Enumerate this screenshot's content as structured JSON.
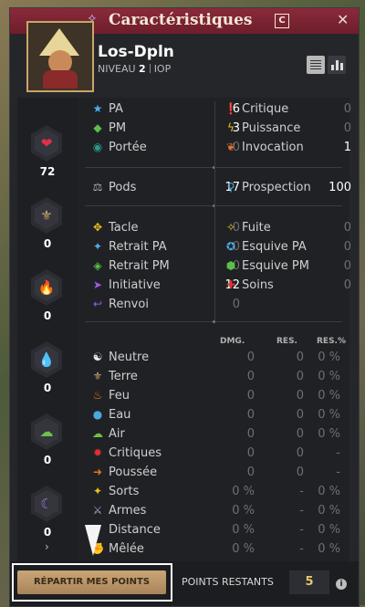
{
  "window": {
    "title": "Caractéristiques",
    "title_badge": "C",
    "close_label": "✕"
  },
  "character": {
    "name": "Los-Dpln",
    "level_label": "NIVEAU",
    "level": "2",
    "class": "IOP"
  },
  "elements_sidebar": [
    {
      "name": "vitalite",
      "icon": "heart-icon",
      "glyph": "❤",
      "color": "#e0304a",
      "value": "72"
    },
    {
      "name": "sagesse",
      "icon": "sprout-icon",
      "glyph": "⚜",
      "color": "#c9a56a",
      "value": "0"
    },
    {
      "name": "force",
      "icon": "flame-icon",
      "glyph": "🔥",
      "color": "#e07a20",
      "value": "0"
    },
    {
      "name": "intelligence",
      "icon": "drop-icon",
      "glyph": "💧",
      "color": "#4aa8e0",
      "value": "0"
    },
    {
      "name": "chance",
      "icon": "cloud-icon",
      "glyph": "☁",
      "color": "#6ac24a",
      "value": "0"
    },
    {
      "name": "agilite",
      "icon": "moon-icon",
      "glyph": "☾",
      "color": "#9a7ae0",
      "value": "0"
    }
  ],
  "sidebar_more": "›",
  "stats_top_left": [
    {
      "label": "PA",
      "value": "6",
      "icon": "star-icon",
      "glyph": "★",
      "color": "#4ab0e8"
    },
    {
      "label": "PM",
      "value": "3",
      "icon": "diamond-icon",
      "glyph": "◆",
      "color": "#5ac04a"
    },
    {
      "label": "Portée",
      "value": "0",
      "icon": "eye-icon",
      "glyph": "◉",
      "color": "#2a9a8a"
    }
  ],
  "stats_top_right": [
    {
      "label": "Critique",
      "value": "0",
      "icon": "exclamation-icon",
      "glyph": "❗",
      "color": "#e03030"
    },
    {
      "label": "Puissance",
      "value": "0",
      "icon": "lightning-icon",
      "glyph": "ϟ",
      "color": "#e8c020"
    },
    {
      "label": "Invocation",
      "value": "1",
      "icon": "invocation-icon",
      "glyph": "❦",
      "color": "#e07030"
    }
  ],
  "pods": {
    "label": "Pods",
    "value": "17",
    "icon": "weight-icon",
    "glyph": "⚖",
    "color": "#b0b0b0"
  },
  "prospection": {
    "label": "Prospection",
    "value": "100",
    "icon": "magnifier-icon",
    "glyph": "⚲",
    "color": "#4ab0e8"
  },
  "stats_mid_left": [
    {
      "label": "Tacle",
      "value": "0",
      "icon": "tackle-icon",
      "glyph": "✥",
      "color": "#e8c020"
    },
    {
      "label": "Retrait PA",
      "value": "0",
      "icon": "ap-reduction-icon",
      "glyph": "✦",
      "color": "#4ab0e8"
    },
    {
      "label": "Retrait PM",
      "value": "0",
      "icon": "mp-reduction-icon",
      "glyph": "◈",
      "color": "#5ac04a"
    },
    {
      "label": "Initiative",
      "value": "12",
      "icon": "initiative-icon",
      "glyph": "➤",
      "color": "#a05ae0"
    },
    {
      "label": "Renvoi",
      "value": "0",
      "icon": "reflect-icon",
      "glyph": "↩",
      "color": "#a05ae0"
    }
  ],
  "stats_mid_right": [
    {
      "label": "Fuite",
      "value": "0",
      "icon": "escape-icon",
      "glyph": "✧",
      "color": "#e8c020"
    },
    {
      "label": "Esquive PA",
      "value": "0",
      "icon": "ap-dodge-icon",
      "glyph": "✪",
      "color": "#4ab0e8"
    },
    {
      "label": "Esquive PM",
      "value": "0",
      "icon": "mp-dodge-icon",
      "glyph": "⬢",
      "color": "#5ac04a"
    },
    {
      "label": "Soins",
      "value": "0",
      "icon": "heal-icon",
      "glyph": "✚",
      "color": "#e03030"
    }
  ],
  "res_headers": {
    "dmg": "DMG.",
    "res": "RES.",
    "res_pct": "RES.%"
  },
  "res_rows": [
    {
      "label": "Neutre",
      "dmg": "0",
      "res": "0",
      "res_pct": "0 %",
      "icon": "yin-yang-icon",
      "glyph": "☯",
      "color": "#e8e8e8"
    },
    {
      "label": "Terre",
      "dmg": "0",
      "res": "0",
      "res_pct": "0 %",
      "icon": "earth-icon",
      "glyph": "⚜",
      "color": "#c9a56a"
    },
    {
      "label": "Feu",
      "dmg": "0",
      "res": "0",
      "res_pct": "0 %",
      "icon": "fire-icon",
      "glyph": "♨",
      "color": "#e07a20"
    },
    {
      "label": "Eau",
      "dmg": "0",
      "res": "0",
      "res_pct": "0 %",
      "icon": "water-icon",
      "glyph": "●",
      "color": "#4aa8e0"
    },
    {
      "label": "Air",
      "dmg": "0",
      "res": "0",
      "res_pct": "0 %",
      "icon": "air-icon",
      "glyph": "☁",
      "color": "#6ac24a"
    },
    {
      "label": "Critiques",
      "dmg": "0",
      "res": "0",
      "res_pct": "-",
      "icon": "critical-icon",
      "glyph": "✹",
      "color": "#e03030"
    },
    {
      "label": "Poussée",
      "dmg": "0",
      "res": "0",
      "res_pct": "-",
      "icon": "push-icon",
      "glyph": "➜",
      "color": "#e07a20"
    },
    {
      "label": "Sorts",
      "dmg": "0 %",
      "res": "-",
      "res_pct": "0 %",
      "icon": "spell-icon",
      "glyph": "✦",
      "color": "#e8c020"
    },
    {
      "label": "Armes",
      "dmg": "0 %",
      "res": "-",
      "res_pct": "0 %",
      "icon": "sword-icon",
      "glyph": "⚔",
      "color": "#a0b0d0"
    },
    {
      "label": "Distance",
      "dmg": "0 %",
      "res": "-",
      "res_pct": "0 %",
      "icon": "bow-icon",
      "glyph": "➶",
      "color": "#c0c0c0"
    },
    {
      "label": "Mêlée",
      "dmg": "0 %",
      "res": "-",
      "res_pct": "0 %",
      "icon": "melee-icon",
      "glyph": "✊",
      "color": "#c0c0c0"
    }
  ],
  "footer": {
    "repartir_label": "RÉPARTIR MES POINTS",
    "points_label": "POINTS RESTANTS",
    "points_value": "5",
    "info_label": "i"
  }
}
